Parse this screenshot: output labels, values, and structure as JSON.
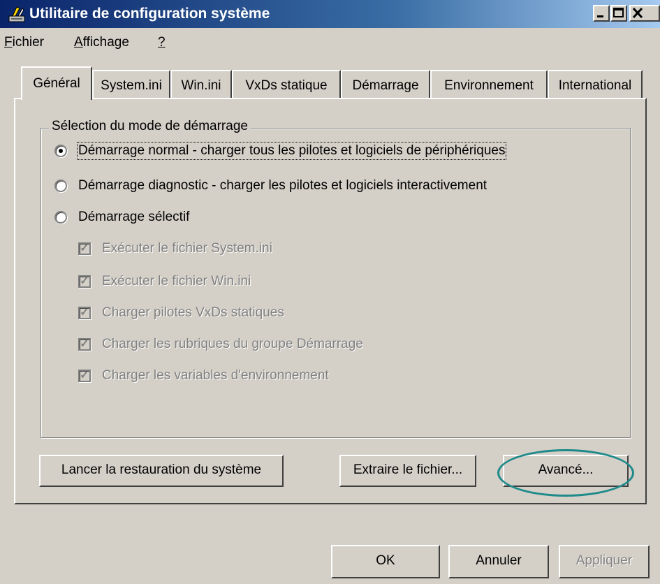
{
  "window": {
    "title": "Utilitaire de configuration système",
    "buttons": [
      "minimize",
      "maximize",
      "close"
    ]
  },
  "menu": [
    {
      "label": "Fichier",
      "accel": "F"
    },
    {
      "label": "Affichage",
      "accel": "A"
    },
    {
      "label": "?",
      "accel": "?"
    }
  ],
  "tabs": [
    "Général",
    "System.ini",
    "Win.ini",
    "VxDs statique",
    "Démarrage",
    "Environnement",
    "International"
  ],
  "active_tab": "Général",
  "group": {
    "title": "Sélection du mode de démarrage",
    "radios": [
      {
        "label": "Démarrage normal - charger tous les pilotes et logiciels de périphériques",
        "checked": true
      },
      {
        "label": "Démarrage diagnostic - charger les pilotes et logiciels interactivement",
        "checked": false
      },
      {
        "label": "Démarrage sélectif",
        "checked": false
      }
    ],
    "checkboxes": [
      {
        "label": "Exécuter le fichier System.ini",
        "checked": true,
        "enabled": false
      },
      {
        "label": "Exécuter le fichier Win.ini",
        "checked": true,
        "enabled": false
      },
      {
        "label": "Charger pilotes VxDs statiques",
        "checked": true,
        "enabled": false
      },
      {
        "label": "Charger les rubriques du groupe Démarrage",
        "checked": true,
        "enabled": false
      },
      {
        "label": "Charger les variables d'environnement",
        "checked": true,
        "enabled": false
      }
    ]
  },
  "panel_buttons": {
    "restore": "Lancer la restauration du système",
    "extract": "Extraire le fichier...",
    "advanced": "Avancé..."
  },
  "dialog_buttons": {
    "ok": "OK",
    "cancel": "Annuler",
    "apply": "Appliquer"
  },
  "colors": {
    "title_bar_start": "#0a246a",
    "title_bar_end": "#a6caf0",
    "face": "#d4d0c8",
    "highlight_ellipse": "#1f8a8a"
  }
}
